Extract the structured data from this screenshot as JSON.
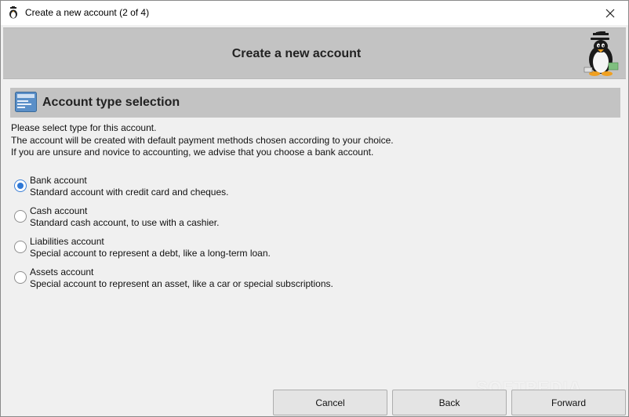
{
  "window": {
    "title": "Create a new account (2 of 4)",
    "icons": {
      "app": "penguin-icon",
      "close": "close-icon"
    }
  },
  "banner": {
    "title": "Create a new account",
    "icon": "penguin-mascot-icon"
  },
  "section": {
    "title": "Account type selection",
    "icon": "bank-card-icon"
  },
  "intro": {
    "line1": "Please select type for this account.",
    "line2": "The account will be created with default payment methods chosen according to your choice.",
    "line3": "If you are unsure and novice to accounting, we advise that you choose a bank account."
  },
  "options": [
    {
      "title": "Bank account",
      "desc": "Standard account with credit card and cheques.",
      "selected": true
    },
    {
      "title": "Cash account",
      "desc": "Standard cash account, to use with a cashier.",
      "selected": false
    },
    {
      "title": "Liabilities account",
      "desc": "Special account to represent a debt, like a long-term loan.",
      "selected": false
    },
    {
      "title": "Assets account",
      "desc": "Special account to represent an asset, like a car or special subscriptions.",
      "selected": false
    }
  ],
  "buttons": {
    "cancel": "Cancel",
    "back": "Back",
    "forward": "Forward"
  },
  "watermark": "SOFTPEDIA",
  "colors": {
    "banner_bg": "#c3c3c3",
    "radio_selected": "#2f78d6",
    "window_bg": "#f0f0f0"
  }
}
